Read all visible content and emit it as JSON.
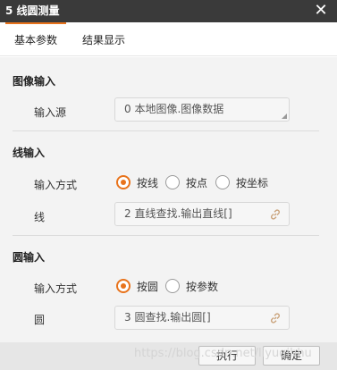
{
  "window": {
    "title": "5 线圆测量",
    "close_glyph": "✕"
  },
  "tabs": [
    {
      "label": "基本参数",
      "active": true
    },
    {
      "label": "结果显示",
      "active": false
    }
  ],
  "image_section": {
    "title": "图像输入",
    "source_label": "输入源",
    "source_value": "0 本地图像.图像数据"
  },
  "line_section": {
    "title": "线输入",
    "mode_label": "输入方式",
    "mode_options": [
      "按线",
      "按点",
      "按坐标"
    ],
    "mode_selected": "按线",
    "line_label": "线",
    "line_value": "2 直线查找.输出直线[]"
  },
  "circle_section": {
    "title": "圆输入",
    "mode_label": "输入方式",
    "mode_options": [
      "按圆",
      "按参数"
    ],
    "mode_selected": "按圆",
    "circle_label": "圆",
    "circle_value": "3 圆查找.输出圆[]"
  },
  "footer": {
    "run_label": "执行",
    "ok_label": "确定"
  },
  "watermark": "https://blog.csdn.net/liyuqihhu",
  "colors": {
    "accent": "#e8731c",
    "titlebar": "#3a3a3a"
  }
}
